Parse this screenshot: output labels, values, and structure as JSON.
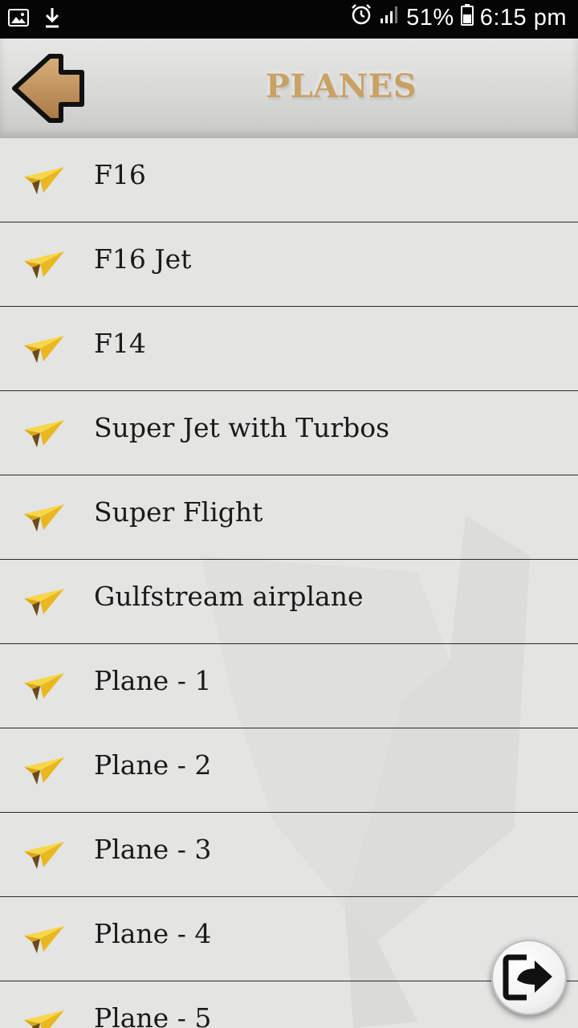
{
  "status_bar": {
    "left_icons": [
      "image-icon",
      "download-icon"
    ],
    "right_icons": [
      "alarm-icon",
      "signal-icon",
      "battery-icon"
    ],
    "battery": "51%",
    "time": "6:15 pm"
  },
  "header": {
    "title": "PLANES",
    "back_icon": "back-arrow-icon",
    "title_color": "#c8a165"
  },
  "list": {
    "item_icon": "paper-plane-icon",
    "items": [
      {
        "label": "F16"
      },
      {
        "label": "F16 Jet"
      },
      {
        "label": "F14"
      },
      {
        "label": "Super Jet with Turbos"
      },
      {
        "label": "Super Flight"
      },
      {
        "label": "Gulfstream airplane"
      },
      {
        "label": "Plane - 1"
      },
      {
        "label": "Plane - 2"
      },
      {
        "label": "Plane - 3"
      },
      {
        "label": "Plane - 4"
      },
      {
        "label": "Plane - 5"
      }
    ]
  },
  "fab": {
    "icon": "exit-icon"
  },
  "colors": {
    "background": "#e4e4e2",
    "accent": "#c8a165",
    "plane_yellow": "#f5cf3a",
    "divider": "#2a2a2a"
  }
}
